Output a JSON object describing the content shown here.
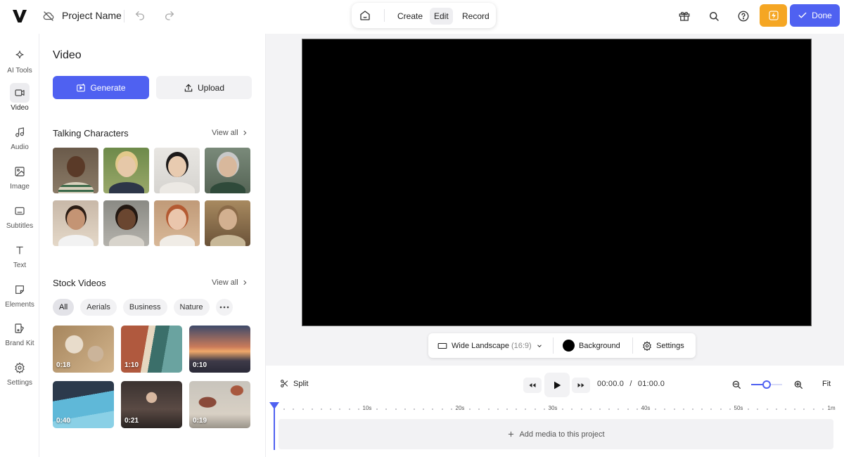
{
  "topbar": {
    "project_name": "Project Name",
    "modes": [
      "Create",
      "Edit",
      "Record"
    ],
    "active_mode": "Edit",
    "done_label": "Done"
  },
  "rail": {
    "items": [
      {
        "label": "AI Tools",
        "icon": "sparkle-icon"
      },
      {
        "label": "Video",
        "icon": "video-camera-icon",
        "active": true
      },
      {
        "label": "Audio",
        "icon": "music-note-icon"
      },
      {
        "label": "Image",
        "icon": "image-icon"
      },
      {
        "label": "Subtitles",
        "icon": "subtitles-icon"
      },
      {
        "label": "Text",
        "icon": "text-icon"
      },
      {
        "label": "Elements",
        "icon": "sticker-icon"
      },
      {
        "label": "Brand Kit",
        "icon": "brand-kit-icon"
      },
      {
        "label": "Settings",
        "icon": "gear-icon"
      }
    ]
  },
  "panel": {
    "title": "Video",
    "generate_label": "Generate",
    "upload_label": "Upload",
    "talking_title": "Talking Characters",
    "stock_title": "Stock Videos",
    "view_all": "View all",
    "chips": [
      "All",
      "Aerials",
      "Business",
      "Nature"
    ],
    "active_chip": "All",
    "stock_videos": [
      {
        "duration": "0:18"
      },
      {
        "duration": "1:10"
      },
      {
        "duration": "0:10"
      },
      {
        "duration": "0:40"
      },
      {
        "duration": "0:21"
      },
      {
        "duration": "0:19"
      }
    ]
  },
  "stage": {
    "aspect_label": "Wide Landscape",
    "aspect_ratio": "(16:9)",
    "background_label": "Background",
    "settings_label": "Settings"
  },
  "timeline": {
    "split_label": "Split",
    "current_time": "00:00.0",
    "separator": "/",
    "total_time": "01:00.0",
    "fit_label": "Fit",
    "zoom_level": 0.5,
    "ruler_labels": [
      "10s",
      "20s",
      "30s",
      "40s",
      "50s",
      "1m"
    ],
    "add_media_label": "Add media to this project"
  },
  "colors": {
    "accent": "#4f61f1",
    "upgrade": "#f5a623",
    "canvas": "#000000"
  }
}
